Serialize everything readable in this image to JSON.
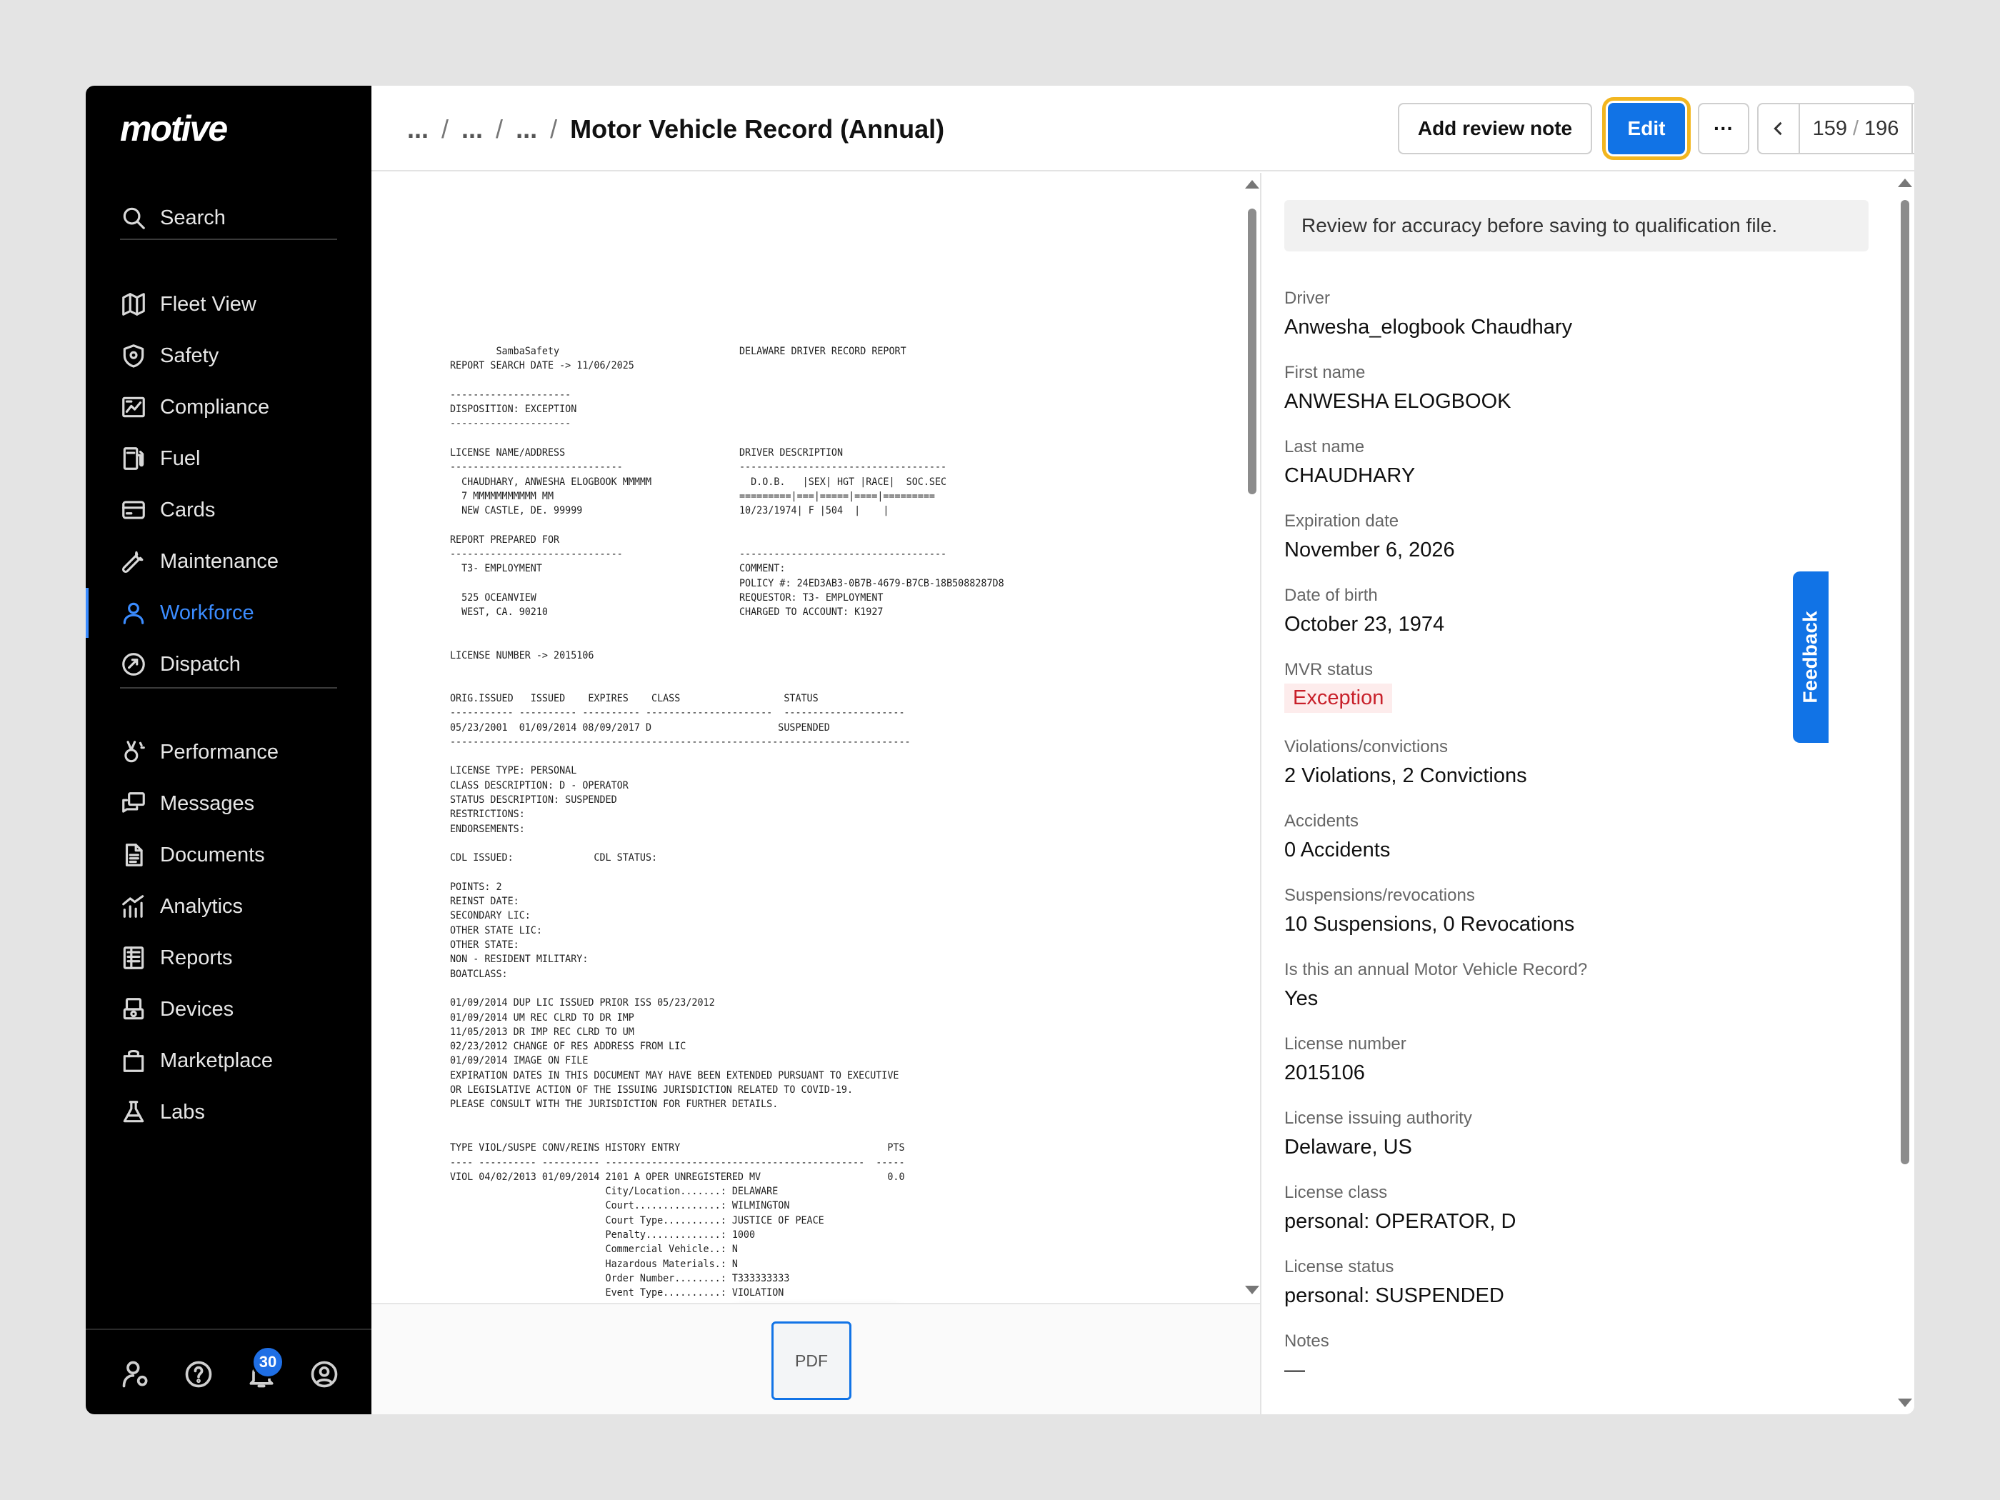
{
  "sidebar": {
    "logo": "motive",
    "search": "Search",
    "items": [
      {
        "label": "Fleet View",
        "icon": "map-icon"
      },
      {
        "label": "Safety",
        "icon": "shield-icon"
      },
      {
        "label": "Compliance",
        "icon": "compliance-chart-icon"
      },
      {
        "label": "Fuel",
        "icon": "fuel-pump-icon"
      },
      {
        "label": "Cards",
        "icon": "card-icon"
      },
      {
        "label": "Maintenance",
        "icon": "wrench-icon"
      },
      {
        "label": "Workforce",
        "icon": "person-icon"
      },
      {
        "label": "Dispatch",
        "icon": "dispatch-icon"
      },
      {
        "label": "Performance",
        "icon": "medal-icon"
      },
      {
        "label": "Messages",
        "icon": "messages-icon"
      },
      {
        "label": "Documents",
        "icon": "document-icon"
      },
      {
        "label": "Analytics",
        "icon": "analytics-icon"
      },
      {
        "label": "Reports",
        "icon": "reports-icon"
      },
      {
        "label": "Devices",
        "icon": "devices-icon"
      },
      {
        "label": "Marketplace",
        "icon": "shopping-bag-icon"
      },
      {
        "label": "Labs",
        "icon": "flask-icon"
      }
    ],
    "active_item": "Workforce",
    "notification_count": "30"
  },
  "header": {
    "breadcrumb": [
      "...",
      "...",
      "..."
    ],
    "separator": "/",
    "title": "Motor Vehicle Record (Annual)",
    "add_review_note": "Add review note",
    "edit": "Edit",
    "more": "···",
    "page_current": "159",
    "page_sep": "/",
    "page_total": "196"
  },
  "document": {
    "text_left": "        SambaSafety\nREPORT SEARCH DATE -> 11/06/2025\n\n---------------------\nDISPOSITION: EXCEPTION\n---------------------\n\nLICENSE NAME/ADDRESS\n------------------------------\n  CHAUDHARY, ANWESHA ELOGBOOK MMMMM\n  7 MMMMMMMMMMM MM\n  NEW CASTLE, DE. 99999\n\nREPORT PREPARED FOR\n------------------------------\n  T3- EMPLOYMENT\n\n  525 OCEANVIEW\n  WEST, CA. 90210\n\n\nLICENSE NUMBER -> 2015106",
    "text_right": "DELAWARE DRIVER RECORD REPORT\n\n\n\n\n\n\nDRIVER DESCRIPTION\n------------------------------------\n  D.O.B.   |SEX| HGT |RACE|  SOC.SEC\n=========|===|=====|====|=========\n10/23/1974| F |504  |    |\n\n\n------------------------------------\nCOMMENT:\nPOLICY #: 24ED3AB3-0B7B-4679-B7CB-18B5088287D8\nREQUESTOR: T3- EMPLOYMENT\nCHARGED TO ACCOUNT: K1927",
    "text_main": "ORIG.ISSUED   ISSUED    EXPIRES    CLASS                  STATUS\n----------- ---------- ---------- ----------------------  ---------------------\n05/23/2001  01/09/2014 08/09/2017 D                      SUSPENDED\n--------------------------------------------------------------------------------\n\nLICENSE TYPE: PERSONAL\nCLASS DESCRIPTION: D - OPERATOR\nSTATUS DESCRIPTION: SUSPENDED\nRESTRICTIONS:\nENDORSEMENTS:\n\nCDL ISSUED:              CDL STATUS:\n\nPOINTS: 2\nREINST DATE:\nSECONDARY LIC:\nOTHER STATE LIC:\nOTHER STATE:\nNON - RESIDENT MILITARY:\nBOATCLASS:\n\n01/09/2014 DUP LIC ISSUED PRIOR ISS 05/23/2012\n01/09/2014 UM REC CLRD TO DR IMP\n11/05/2013 DR IMP REC CLRD TO UM\n02/23/2012 CHANGE OF RES ADDRESS FROM LIC\n01/09/2014 IMAGE ON FILE\nEXPIRATION DATES IN THIS DOCUMENT MAY HAVE BEEN EXTENDED PURSUANT TO EXECUTIVE\nOR LEGISLATIVE ACTION OF THE ISSUING JURISDICTION RELATED TO COVID-19.\nPLEASE CONSULT WITH THE JURISDICTION FOR FURTHER DETAILS.\n\n\nTYPE VIOL/SUSPE CONV/REINS HISTORY ENTRY                                    PTS\n---- ---------- ---------- ---------------------------------------------  -----\nVIOL 04/02/2013 01/09/2014 2101 A OPER UNREGISTERED MV                      0.0\n                           City/Location.......: DELAWARE\n                           Court...............: WILMINGTON\n                           Court Type..........: JUSTICE OF PEACE\n                           Penalty.............: 1000\n                           Commercial Vehicle..: N\n                           Hazardous Materials.: N\n                           Order Number........: T333333333\n                           Event Type..........: VIOLATION",
    "thumbnail_label": "PDF"
  },
  "details": {
    "review_message": "Review for accuracy before saving to qualification file.",
    "fields": [
      {
        "label": "Driver",
        "value": "Anwesha_elogbook Chaudhary"
      },
      {
        "label": "First name",
        "value": "ANWESHA ELOGBOOK"
      },
      {
        "label": "Last name",
        "value": "CHAUDHARY"
      },
      {
        "label": "Expiration date",
        "value": "November 6, 2026"
      },
      {
        "label": "Date of birth",
        "value": "October 23, 1974"
      },
      {
        "label": "MVR status",
        "value": "Exception"
      },
      {
        "label": "Violations/convictions",
        "value": "2 Violations, 2 Convictions"
      },
      {
        "label": "Accidents",
        "value": "0 Accidents"
      },
      {
        "label": "Suspensions/revocations",
        "value": "10 Suspensions, 0 Revocations"
      },
      {
        "label": "Is this an annual Motor Vehicle Record?",
        "value": "Yes"
      },
      {
        "label": "License number",
        "value": "2015106"
      },
      {
        "label": "License issuing authority",
        "value": "Delaware, US"
      },
      {
        "label": "License class",
        "value": "personal: OPERATOR, D"
      },
      {
        "label": "License status",
        "value": "personal: SUSPENDED"
      },
      {
        "label": "Notes",
        "value": "—"
      }
    ],
    "feedback": "Feedback"
  },
  "colors": {
    "accent": "#1173e6",
    "focus_ring": "#f2b620",
    "exception_text": "#c8202a",
    "exception_bg": "#fdecec",
    "sidebar_bg": "#000000"
  }
}
